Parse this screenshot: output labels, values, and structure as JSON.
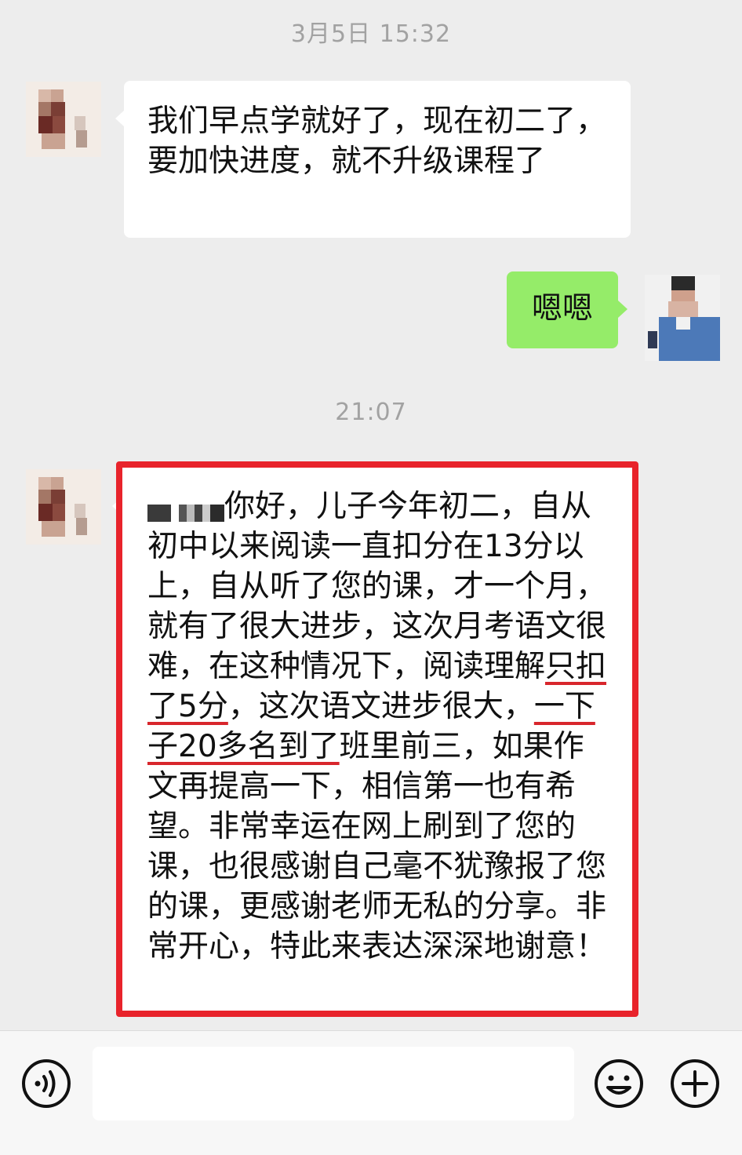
{
  "chat": {
    "timestamp_1": "3月5日 15:32",
    "msg_1": "我们早点学就好了，现在初二了，要加快进度，就不升级课程了",
    "reply_1": "嗯嗯",
    "timestamp_2": "21:07",
    "msg_2": {
      "p1": "你好，儿子今年初二，自从初中以来阅读一直扣分在13分以上，自从听了您的课，才一个月，就有了很大进步，这次月考语文很难，在这种情况下，阅读理解",
      "hl1": "只扣了5分",
      "p2": "，这次语文进步很大，",
      "hl2": "一下子20多名到了",
      "p3": "班里前三，如果作文再提高一下，相信第一也有希望。非常幸运在网上刷到了您的课，也很感谢自己毫不犹豫报了您的课，更感谢老师无私的分享。非常开心，特此来表达深深地谢意！"
    }
  },
  "input_bar": {
    "voice_icon": "voice-icon",
    "emoji_icon": "emoji-icon",
    "plus_icon": "plus-icon"
  },
  "colors": {
    "background": "#ededed",
    "bubble_in": "#ffffff",
    "bubble_out": "#95ec69",
    "highlight_border": "#e8232b",
    "underline": "#d8262c"
  }
}
